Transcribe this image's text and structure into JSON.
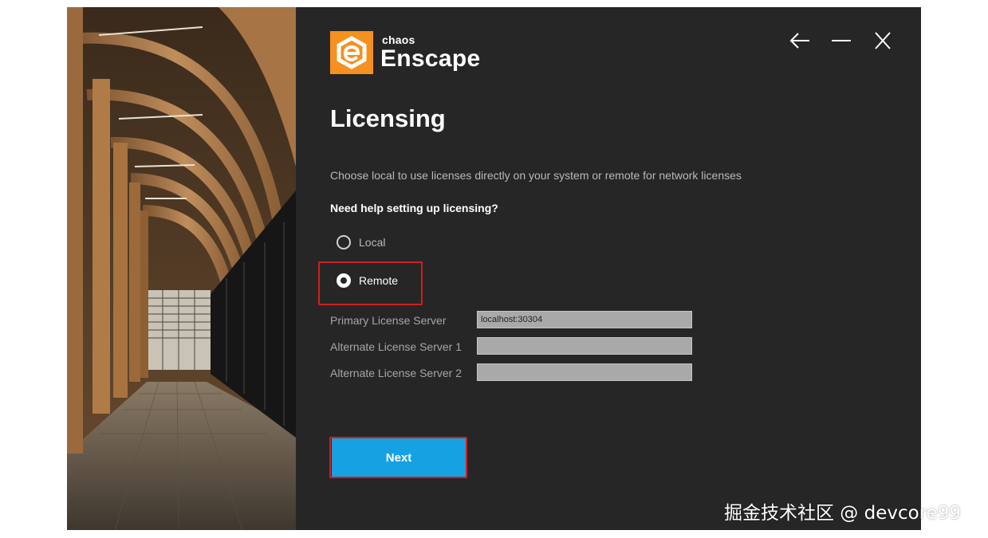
{
  "brand": {
    "small": "chaos",
    "big": "Enscape",
    "accent": "#f6901e"
  },
  "window_controls": {
    "back": "arrow-left-icon",
    "minimize": "minimize-icon",
    "close": "close-icon"
  },
  "page": {
    "title": "Licensing",
    "description": "Choose local to use licenses directly on your system or remote for network licenses",
    "help_link": "Need help setting up licensing?"
  },
  "license_mode": {
    "options": [
      {
        "label": "Local",
        "selected": false
      },
      {
        "label": "Remote",
        "selected": true
      }
    ]
  },
  "servers": [
    {
      "label": "Primary License Server",
      "value": "localhost:30304"
    },
    {
      "label": "Alternate License Server 1",
      "value": ""
    },
    {
      "label": "Alternate License Server 2",
      "value": ""
    }
  ],
  "next_button": {
    "label": "Next",
    "color": "#16a1e3"
  },
  "highlight_color": "#d21f1f",
  "watermark": "掘金技术社区 @ devcore99"
}
